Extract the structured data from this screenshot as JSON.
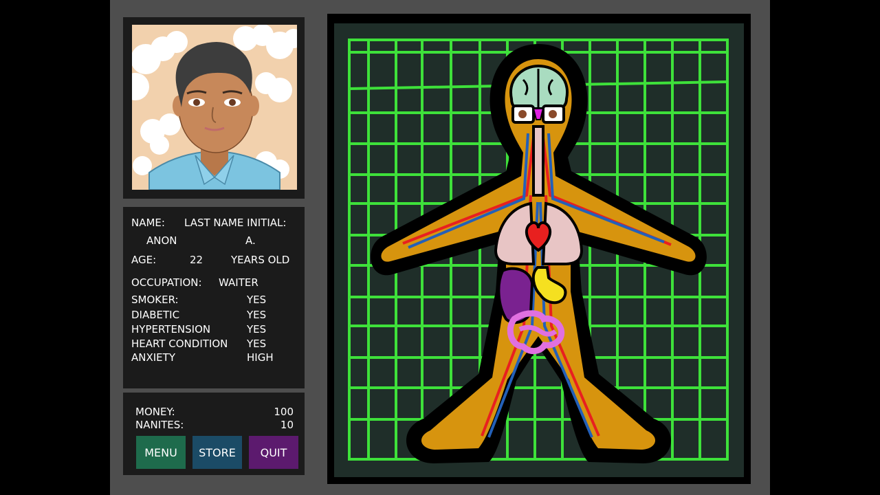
{
  "profile": {
    "name_label": "NAME:",
    "last_initial_label": "LAST NAME INITIAL:",
    "name_value": "ANON",
    "last_initial_value": "A.",
    "age_label": "AGE:",
    "age_value": "22",
    "age_unit": "YEARS OLD",
    "occupation_label": "OCCUPATION:",
    "occupation_value": "WAITER",
    "conditions": [
      {
        "label": "SMOKER:",
        "value": "YES"
      },
      {
        "label": "DIABETIC",
        "value": "YES"
      },
      {
        "label": "HYPERTENSION",
        "value": "YES"
      },
      {
        "label": "HEART CONDITION",
        "value": "YES"
      },
      {
        "label": "ANXIETY",
        "value": "HIGH"
      }
    ]
  },
  "resources": {
    "money_label": "MONEY:",
    "money_value": "100",
    "nanites_label": "NANITES:",
    "nanites_value": "10"
  },
  "buttons": {
    "menu": "MENU",
    "store": "STORE",
    "quit": "QUIT"
  },
  "colors": {
    "menu_button": "#1e6b4c",
    "store_button": "#1b4b66",
    "quit_button": "#5c1a6e",
    "grid": "#3ee13a",
    "skin_body": "#d7940e",
    "artery": "#e8201f",
    "vein": "#2460b8"
  }
}
